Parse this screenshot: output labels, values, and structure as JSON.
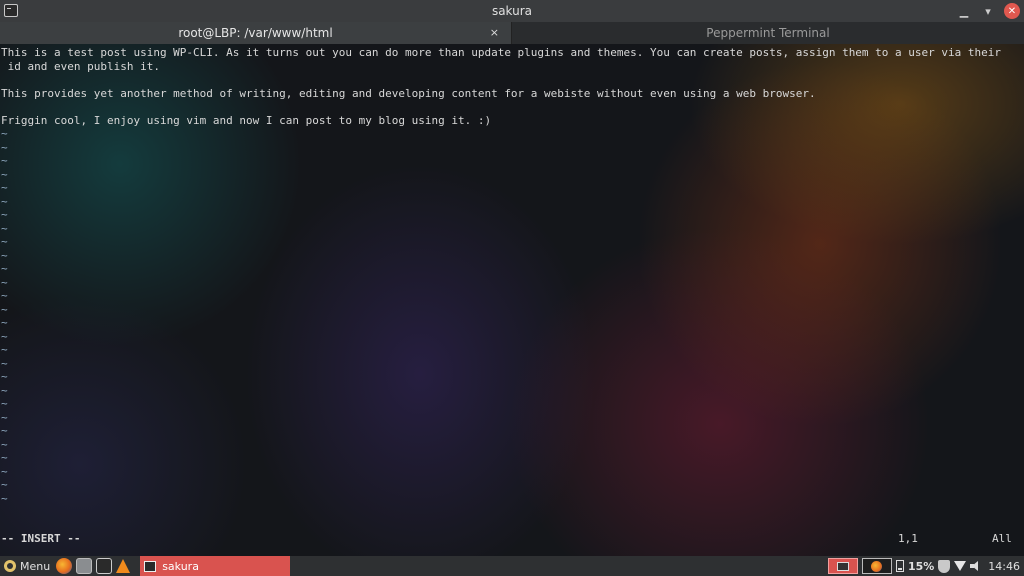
{
  "window": {
    "title": "sakura"
  },
  "tabs": [
    {
      "label": "root@LBP: /var/www/html",
      "close": "×"
    },
    {
      "label": "Peppermint Terminal"
    }
  ],
  "editor": {
    "lines": [
      "This is a test post using WP-CLI. As it turns out you can do more than update plugins and themes. You can create posts, assign them to a user via their",
      " id and even publish it.",
      "",
      "This provides yet another method of writing, editing and developing content for a webiste without even using a web browser.",
      "",
      "Friggin cool, I enjoy using vim and now I can post to my blog using it. :)"
    ],
    "tilde": "~",
    "tilde_count": 28,
    "mode": "-- INSERT --",
    "position": "1,1",
    "scroll": "All"
  },
  "taskbar": {
    "menu_label": "Menu",
    "task_label": "sakura",
    "battery": "15%",
    "clock": "14:46"
  }
}
